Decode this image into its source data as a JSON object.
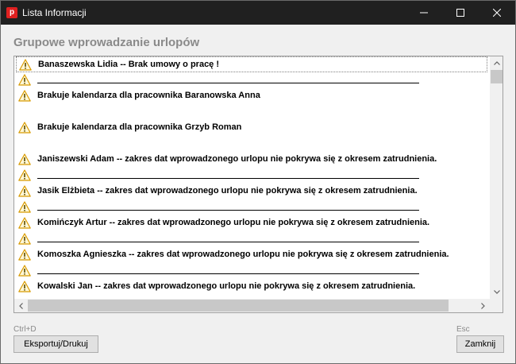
{
  "window": {
    "title": "Lista Informacji",
    "app_icon_letter": "p",
    "colors": {
      "titlebar": "#202020",
      "app_icon": "#e02020",
      "warning": "#f2b400"
    }
  },
  "heading": "Grupowe wprowadzanie urlopów",
  "messages": [
    {
      "icon": "warning-icon",
      "text": "Banaszewska Lidia -- Brak umowy o pracę  !",
      "selected": true,
      "separator": false
    },
    {
      "icon": "warning-icon",
      "text": "",
      "selected": false,
      "separator": true
    },
    {
      "icon": "warning-icon",
      "text": "Brakuje kalendarza dla pracownika Baranowska Anna",
      "selected": false,
      "separator": false
    },
    {
      "icon": "",
      "text": "",
      "selected": false,
      "separator": false
    },
    {
      "icon": "warning-icon",
      "text": "Brakuje kalendarza dla pracownika Grzyb Roman",
      "selected": false,
      "separator": false
    },
    {
      "icon": "",
      "text": "",
      "selected": false,
      "separator": false
    },
    {
      "icon": "warning-icon",
      "text": "Janiszewski Adam -- zakres dat wprowadzonego urlopu nie pokrywa się z okresem zatrudnienia.",
      "selected": false,
      "separator": false
    },
    {
      "icon": "warning-icon",
      "text": "",
      "selected": false,
      "separator": true
    },
    {
      "icon": "warning-icon",
      "text": "Jasik Elżbieta -- zakres dat wprowadzonego urlopu nie pokrywa się z okresem zatrudnienia.",
      "selected": false,
      "separator": false
    },
    {
      "icon": "warning-icon",
      "text": "",
      "selected": false,
      "separator": true
    },
    {
      "icon": "warning-icon",
      "text": "Komińczyk Artur -- zakres dat wprowadzonego urlopu nie pokrywa się z okresem zatrudnienia.",
      "selected": false,
      "separator": false
    },
    {
      "icon": "warning-icon",
      "text": "",
      "selected": false,
      "separator": true
    },
    {
      "icon": "warning-icon",
      "text": "Komoszka Agnieszka -- zakres dat wprowadzonego urlopu nie pokrywa się z okresem zatrudnienia.",
      "selected": false,
      "separator": false
    },
    {
      "icon": "warning-icon",
      "text": "",
      "selected": false,
      "separator": true
    },
    {
      "icon": "warning-icon",
      "text": "Kowalski Jan -- zakres dat wprowadzonego urlopu nie pokrywa się z okresem zatrudnienia.",
      "selected": false,
      "separator": false
    }
  ],
  "footer": {
    "export_shortcut": "Ctrl+D",
    "export_label": "Eksportuj/Drukuj",
    "close_shortcut": "Esc",
    "close_label": "Zamknij"
  }
}
